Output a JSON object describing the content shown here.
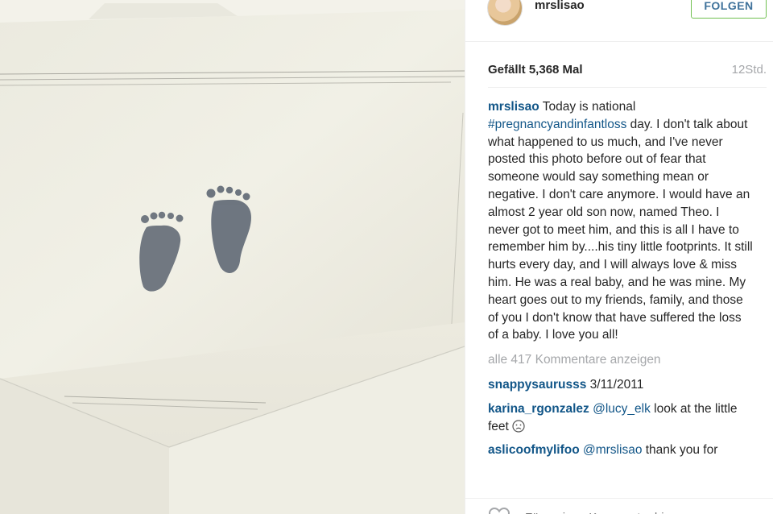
{
  "post": {
    "username": "mrslisao",
    "follow_label": "FOLGEN",
    "likes": "Gefällt 5,368 Mal",
    "time": "12Std.",
    "caption_user": "mrslisao",
    "caption_part1": "Today is national ",
    "caption_hashtag": "#pregnancyandinfantloss",
    "caption_part2": " day. I don't talk about what happened to us much, and I've never posted this photo before out of fear that someone would say something mean or negative. I don't care anymore. I would have an almost 2 year old son now, named Theo. I never got to meet him, and this is all I have to remember him by....his tiny little footprints. It still hurts every day, and I will always love & miss him. He was a real baby, and he was mine. My heart goes out to my friends, family, and those of you I don't know that have suffered the loss of a baby. I love you all!",
    "all_comments_label": "alle 417 Kommentare anzeigen"
  },
  "comments": [
    {
      "user": "snappysaurusss",
      "mention": "",
      "text": "3/11/2011",
      "emoji": ""
    },
    {
      "user": "karina_rgonzalez",
      "mention": "@lucy_elk",
      "text": " look at the little feet ",
      "emoji": "sad-face"
    },
    {
      "user": "aslicoofmylifoo",
      "mention": "@mrslisao",
      "text": " thank you for",
      "emoji": ""
    }
  ],
  "comment_input": {
    "placeholder": "Füge einen Kommentar hinzu..."
  },
  "colors": {
    "link": "#125688",
    "follow_text": "#3f729b",
    "follow_border": "#70c050",
    "muted": "#a5a7aa"
  },
  "icons": {
    "like": "heart-outline-icon"
  }
}
